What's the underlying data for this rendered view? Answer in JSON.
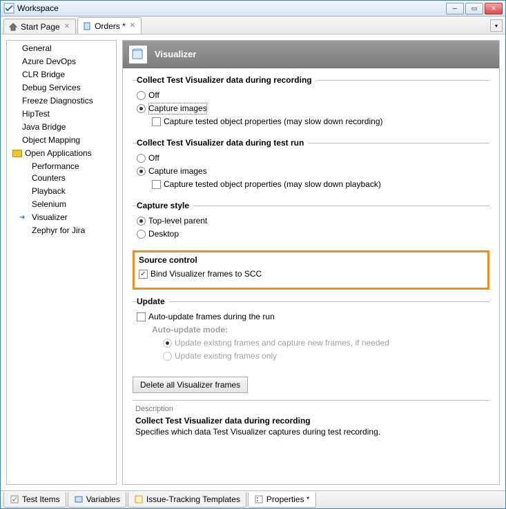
{
  "window": {
    "title": "Workspace"
  },
  "tabs": {
    "start": "Start Page",
    "orders": "Orders *"
  },
  "sidebar": {
    "items": [
      "General",
      "Azure DevOps",
      "CLR Bridge",
      "Debug Services",
      "Freeze Diagnostics",
      "HipTest",
      "Java Bridge",
      "Object Mapping"
    ],
    "openapps": "Open Applications",
    "sub": [
      "Performance Counters",
      "Playback",
      "Selenium",
      "Visualizer",
      "Zephyr for Jira"
    ]
  },
  "panel": {
    "title": "Visualizer",
    "recording": {
      "legend": "Collect Test Visualizer data during recording",
      "off": "Off",
      "capture": "Capture images",
      "props": "Capture tested object properties (may slow down recording)"
    },
    "testrun": {
      "legend": "Collect Test Visualizer data during test run",
      "off": "Off",
      "capture": "Capture images",
      "props": "Capture tested object properties (may slow down playback)"
    },
    "capstyle": {
      "legend": "Capture style",
      "top": "Top-level parent",
      "desktop": "Desktop"
    },
    "scc": {
      "legend": "Source control",
      "bind": "Bind Visualizer frames to SCC"
    },
    "update": {
      "legend": "Update",
      "auto": "Auto-update frames during the run",
      "mode": "Auto-update mode:",
      "opt1": "Update existing frames and capture new frames, if needed",
      "opt2": "Update existing frames only"
    },
    "deletebtn": "Delete all Visualizer frames",
    "desc": {
      "label": "Description",
      "head": "Collect Test Visualizer data during recording",
      "body": "Specifies which data Test Visualizer captures during test recording."
    }
  },
  "bottomTabs": {
    "items": [
      "Test Items",
      "Variables",
      "Issue-Tracking Templates",
      "Properties *"
    ]
  }
}
